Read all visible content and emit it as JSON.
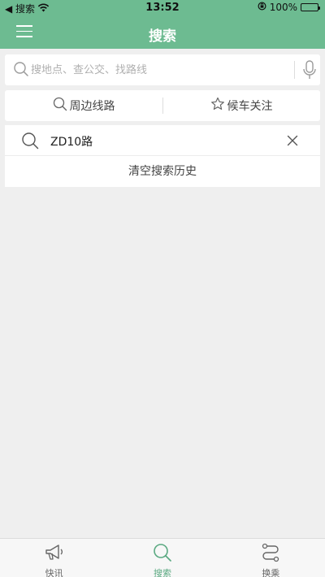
{
  "status_bar": {
    "back_label": "◀ 搜索",
    "time": "13:52",
    "battery": "100%"
  },
  "header": {
    "title": "搜索"
  },
  "search": {
    "placeholder": "搜地点、查公交、找路线"
  },
  "actions": [
    {
      "label": "周边线路",
      "icon": "search-icon"
    },
    {
      "label": "候车关注",
      "icon": "star-icon"
    }
  ],
  "history": {
    "items": [
      {
        "text": "ZD10路"
      }
    ],
    "clear_label": "清空搜索历史"
  },
  "tabbar": {
    "tabs": [
      {
        "label": "快讯",
        "icon": "megaphone-icon"
      },
      {
        "label": "搜索",
        "icon": "search-icon",
        "active": true
      },
      {
        "label": "换乘",
        "icon": "route-icon"
      }
    ]
  },
  "colors": {
    "brand": "#6dbb91",
    "active_tab": "#5aa981",
    "background": "#efefef"
  }
}
